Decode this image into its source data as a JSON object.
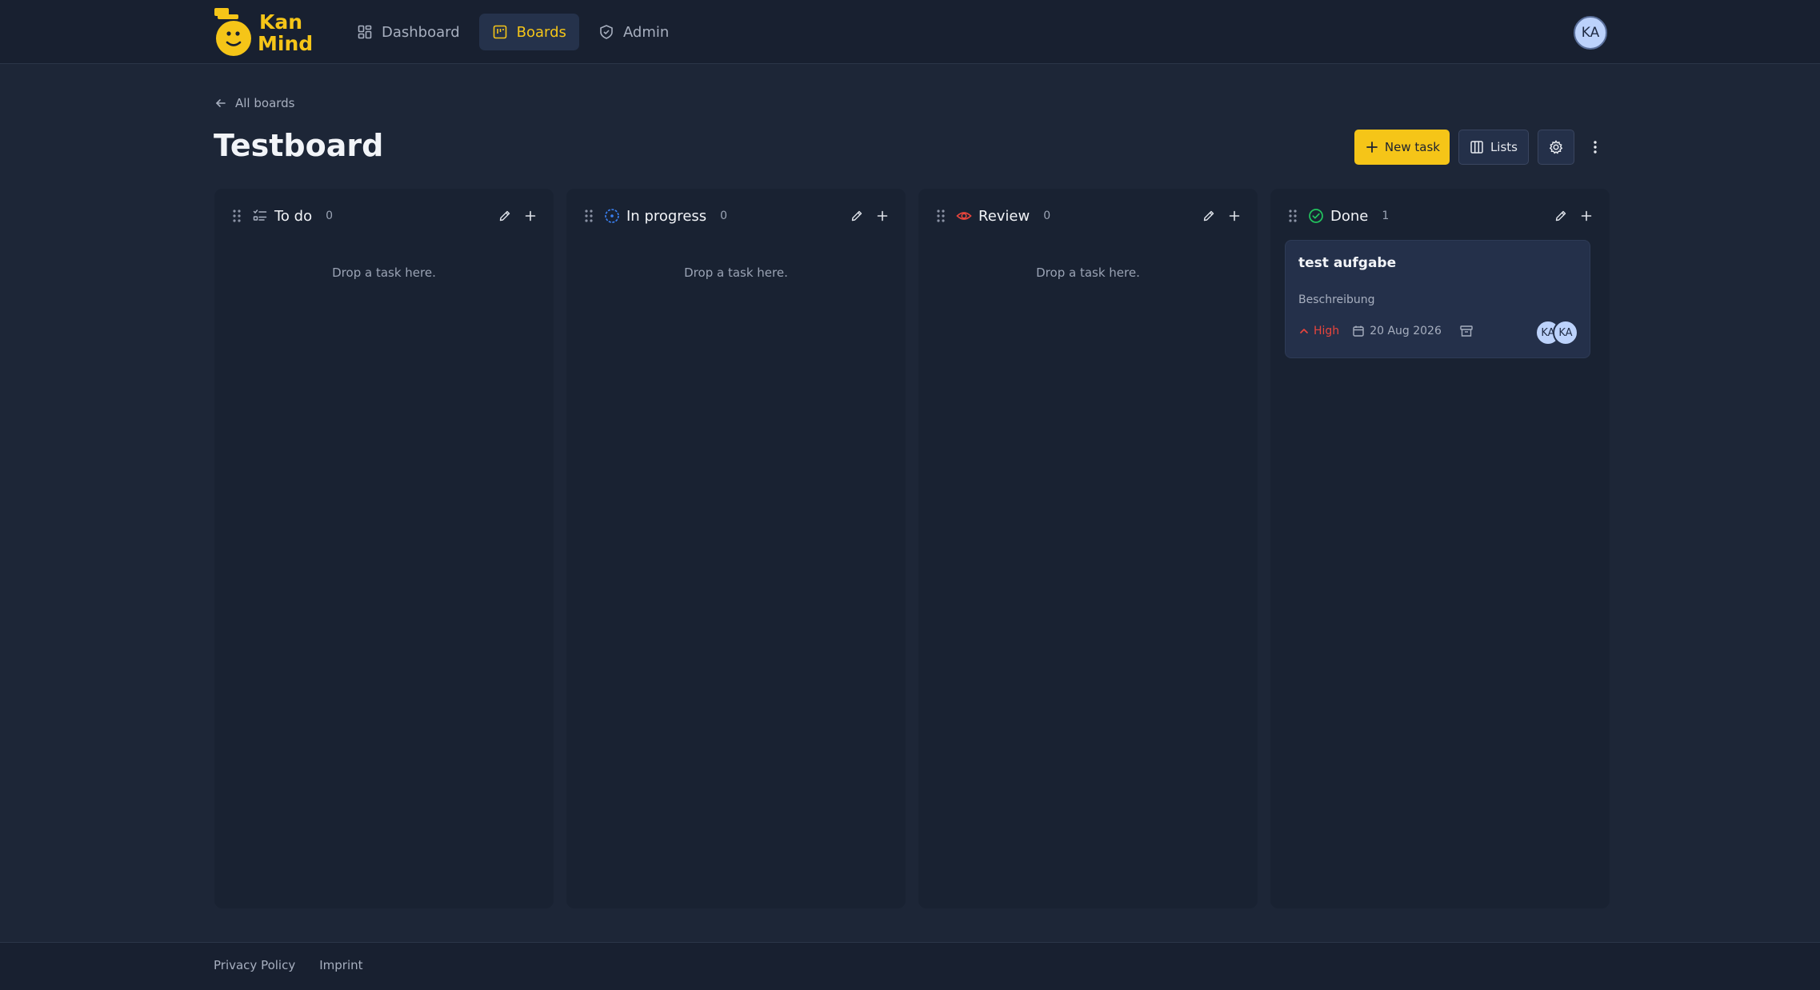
{
  "app": {
    "logo_text_line1": "Kan",
    "logo_text_line2": "Mind",
    "accent_color": "#f5c518"
  },
  "nav": {
    "items": [
      {
        "label": "Dashboard",
        "icon": "dashboard-icon",
        "active": false
      },
      {
        "label": "Boards",
        "icon": "board-icon",
        "active": true
      },
      {
        "label": "Admin",
        "icon": "shield-icon",
        "active": false
      }
    ],
    "user_initials": "KA"
  },
  "header": {
    "back_label": "All boards",
    "title": "Testboard",
    "new_task_label": "New task",
    "lists_label": "Lists"
  },
  "columns": [
    {
      "title": "To do",
      "count": "0",
      "icon": "checklist-icon",
      "icon_color": "#a7afbf",
      "empty_text": "Drop a task here."
    },
    {
      "title": "In progress",
      "count": "0",
      "icon": "progress-icon",
      "icon_color": "#3b82f6",
      "empty_text": "Drop a task here."
    },
    {
      "title": "Review",
      "count": "0",
      "icon": "eye-icon",
      "icon_color": "#e8453c",
      "empty_text": "Drop a task here."
    },
    {
      "title": "Done",
      "count": "1",
      "icon": "check-circle-icon",
      "icon_color": "#22c55e",
      "empty_text": ""
    }
  ],
  "task": {
    "title": "test aufgabe",
    "description": "Beschreibung",
    "priority": "High",
    "priority_color": "#e8453c",
    "due_date": "20 Aug 2026",
    "assignees": [
      "KA",
      "KA"
    ]
  },
  "footer": {
    "privacy_label": "Privacy Policy",
    "imprint_label": "Imprint"
  }
}
